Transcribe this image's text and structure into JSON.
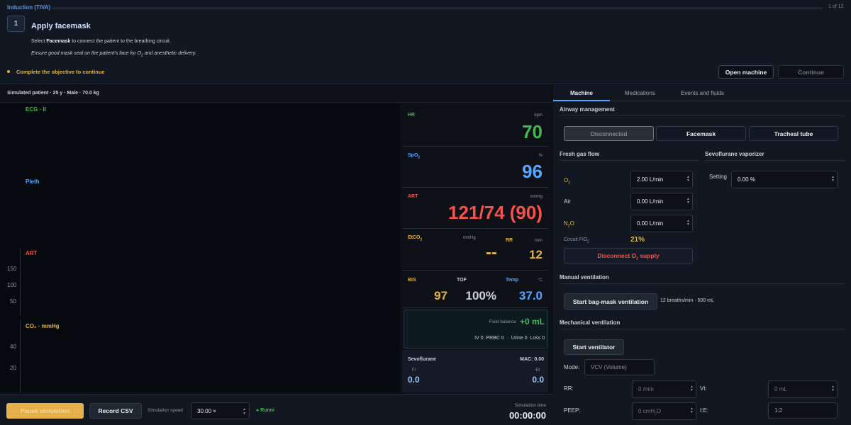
{
  "header": {
    "crumb": "Induction (TIVA)",
    "step_count": "1 of 12",
    "step_number": "1",
    "step_title": "Apply facemask",
    "instr_pre": "Select ",
    "instr_bold": "Facemask",
    "instr_post": " to connect the patient to the breathing circuit.",
    "note_pre": "Ensure good mask seal on the patient's face for O",
    "note_sub": "2",
    "note_post": " and anesthetic delivery.",
    "objective": "Complete the objective to continue",
    "open_machine": "Open machine",
    "continue": "Continue",
    "progress_fraction": 0.0
  },
  "patient": "Simulated patient  ·  25 y  ·  Male  ·  70.0 kg",
  "waves": {
    "ecg": "ECG · II",
    "pleth": "Pleth",
    "art": "ART",
    "co2": "CO₂ · mmHg",
    "art_ticks": [
      "150",
      "100",
      "50"
    ],
    "co2_ticks": [
      "40",
      "20"
    ]
  },
  "vitals": {
    "hr": {
      "label": "HR",
      "unit": "bpm",
      "value": "70"
    },
    "spo2": {
      "label": "SpO",
      "sub": "2",
      "unit": "%",
      "value": "96"
    },
    "art": {
      "label": "ART",
      "unit": "mmHg",
      "value": "121/74 (90)"
    },
    "etco2": {
      "label": "EtCO",
      "sub": "2",
      "unit": "mmHg",
      "value": "--"
    },
    "rr": {
      "label": "RR",
      "unit": "/min",
      "value": "12"
    },
    "bis": {
      "label": "BIS",
      "value": "97"
    },
    "tof": {
      "label": "TOF",
      "value": "100%"
    },
    "temp": {
      "label": "Temp",
      "unit": "°C",
      "value": "37.0"
    },
    "fluid": {
      "label": "Fluid balance",
      "value": "+0 mL",
      "detail": "IV 0  PRBC 0  ·  Urine 0  Loss 0"
    },
    "sevo": {
      "label": "Sevoflurane",
      "mac": "MAC: 0.00",
      "fi_label": "Fi",
      "fi": "0.0",
      "et_label": "Et",
      "et": "0.0"
    }
  },
  "controls": {
    "pause": "Pause simulation",
    "record": "Record CSV",
    "speed_label": "Simulation speed",
    "speed_value": "30.00 ×",
    "running": "● Runni",
    "time_label": "Simulation time",
    "time_value": "00:00:00"
  },
  "tabs": [
    "Machine",
    "Medications",
    "Events and fluids"
  ],
  "airway": {
    "title": "Airway management",
    "options": [
      "Disconnected",
      "Facemask",
      "Tracheal tube"
    ]
  },
  "fgf": {
    "title": "Fresh gas flow",
    "o2_label": "O",
    "o2_sub": "2",
    "o2_value": "2.00 L/min",
    "air_label": "Air",
    "air_value": "0.00 L/min",
    "n2o_label": "N",
    "n2o_sub": "2",
    "n2o_label_post": "O",
    "n2o_value": "0.00 L/min",
    "fio2_label": "Circuit FiO",
    "fio2_sub": "2",
    "fio2_value": "21%",
    "disconnect_pre": "Disconnect O",
    "disconnect_sub": "2",
    "disconnect_post": " supply"
  },
  "vaporizer": {
    "title": "Sevoflurane vaporizer",
    "setting_label": "Setting",
    "setting_value": "0.00 %"
  },
  "manual": {
    "title": "Manual ventilation",
    "button": "Start bag-mask ventilation",
    "detail": "12 breaths/min · 500 mL"
  },
  "mech": {
    "title": "Mechanical ventilation",
    "button": "Start ventilator",
    "mode_label": "Mode:",
    "mode_value": "VCV (Volume)",
    "rr_label": "RR:",
    "rr_placeholder": "0 /min",
    "vt_label": "Vt:",
    "vt_placeholder": "0 mL",
    "peep_label": "PEEP:",
    "peep_pre": "0 cmH",
    "peep_sub": "2",
    "peep_post": "O",
    "ie_label": "I:E:",
    "ie_value": "1:2"
  },
  "colors": {
    "ecg": "#3fb950",
    "pleth": "#58a6ff",
    "art": "#f85149",
    "co2": "#e3b341",
    "accent": "#58a6ff",
    "pause": "#e8b04a"
  }
}
